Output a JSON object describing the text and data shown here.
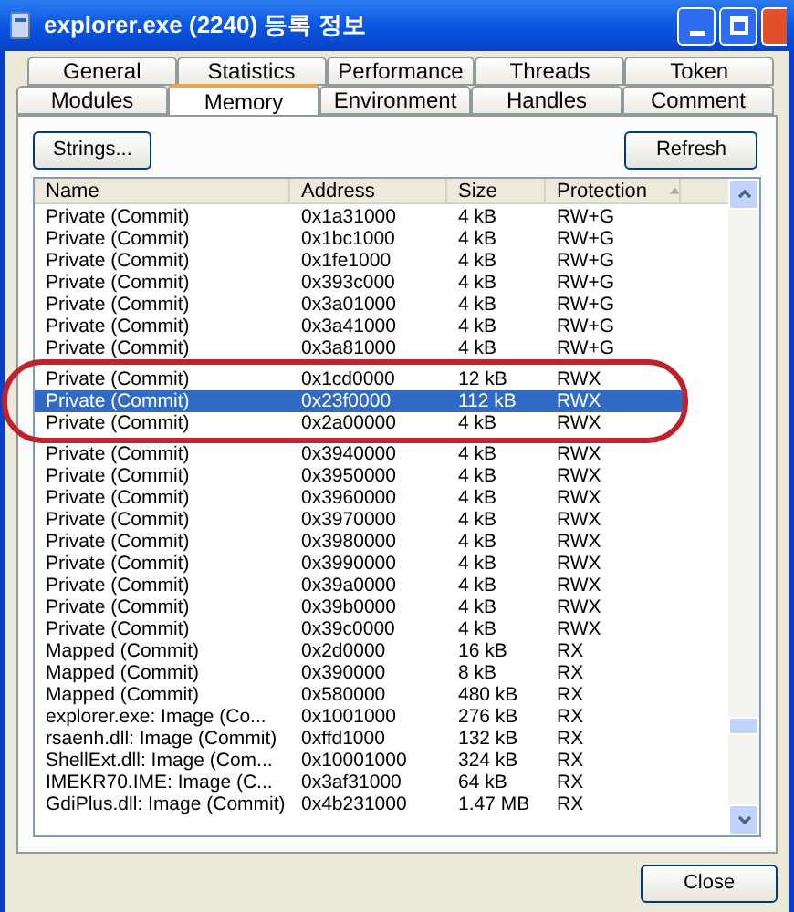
{
  "window": {
    "title": "explorer.exe (2240) 등록 정보"
  },
  "tab_rows": [
    [
      {
        "label": "General",
        "selected": false
      },
      {
        "label": "Statistics",
        "selected": false
      },
      {
        "label": "Performance",
        "selected": false
      },
      {
        "label": "Threads",
        "selected": false
      },
      {
        "label": "Token",
        "selected": false
      }
    ],
    [
      {
        "label": "Modules",
        "selected": false
      },
      {
        "label": "Memory",
        "selected": true
      },
      {
        "label": "Environment",
        "selected": false
      },
      {
        "label": "Handles",
        "selected": false
      },
      {
        "label": "Comment",
        "selected": false
      }
    ]
  ],
  "buttons": {
    "strings": "Strings...",
    "refresh": "Refresh",
    "close": "Close"
  },
  "table": {
    "columns": [
      "Name",
      "Address",
      "Size",
      "Protection"
    ],
    "rows": [
      {
        "cells": [
          "Private (Commit)",
          "0x1a31000",
          "4 kB",
          "RW+G"
        ],
        "selected": false,
        "circled": false
      },
      {
        "cells": [
          "Private (Commit)",
          "0x1bc1000",
          "4 kB",
          "RW+G"
        ],
        "selected": false,
        "circled": false
      },
      {
        "cells": [
          "Private (Commit)",
          "0x1fe1000",
          "4 kB",
          "RW+G"
        ],
        "selected": false,
        "circled": false
      },
      {
        "cells": [
          "Private (Commit)",
          "0x393c000",
          "4 kB",
          "RW+G"
        ],
        "selected": false,
        "circled": false
      },
      {
        "cells": [
          "Private (Commit)",
          "0x3a01000",
          "4 kB",
          "RW+G"
        ],
        "selected": false,
        "circled": false
      },
      {
        "cells": [
          "Private (Commit)",
          "0x3a41000",
          "4 kB",
          "RW+G"
        ],
        "selected": false,
        "circled": false
      },
      {
        "cells": [
          "Private (Commit)",
          "0x3a81000",
          "4 kB",
          "RW+G"
        ],
        "selected": false,
        "circled": false
      },
      {
        "cells": [
          "Private (Commit)",
          "0x1cd0000",
          "12 kB",
          "RWX"
        ],
        "selected": false,
        "circled": true
      },
      {
        "cells": [
          "Private (Commit)",
          "0x23f0000",
          "112 kB",
          "RWX"
        ],
        "selected": true,
        "circled": true
      },
      {
        "cells": [
          "Private (Commit)",
          "0x2a00000",
          "4 kB",
          "RWX"
        ],
        "selected": false,
        "circled": true
      },
      {
        "cells": [
          "Private (Commit)",
          "0x3940000",
          "4 kB",
          "RWX"
        ],
        "selected": false,
        "circled": false
      },
      {
        "cells": [
          "Private (Commit)",
          "0x3950000",
          "4 kB",
          "RWX"
        ],
        "selected": false,
        "circled": false
      },
      {
        "cells": [
          "Private (Commit)",
          "0x3960000",
          "4 kB",
          "RWX"
        ],
        "selected": false,
        "circled": false
      },
      {
        "cells": [
          "Private (Commit)",
          "0x3970000",
          "4 kB",
          "RWX"
        ],
        "selected": false,
        "circled": false
      },
      {
        "cells": [
          "Private (Commit)",
          "0x3980000",
          "4 kB",
          "RWX"
        ],
        "selected": false,
        "circled": false
      },
      {
        "cells": [
          "Private (Commit)",
          "0x3990000",
          "4 kB",
          "RWX"
        ],
        "selected": false,
        "circled": false
      },
      {
        "cells": [
          "Private (Commit)",
          "0x39a0000",
          "4 kB",
          "RWX"
        ],
        "selected": false,
        "circled": false
      },
      {
        "cells": [
          "Private (Commit)",
          "0x39b0000",
          "4 kB",
          "RWX"
        ],
        "selected": false,
        "circled": false
      },
      {
        "cells": [
          "Private (Commit)",
          "0x39c0000",
          "4 kB",
          "RWX"
        ],
        "selected": false,
        "circled": false
      },
      {
        "cells": [
          "Mapped (Commit)",
          "0x2d0000",
          "16 kB",
          "RX"
        ],
        "selected": false,
        "circled": false
      },
      {
        "cells": [
          "Mapped (Commit)",
          "0x390000",
          "8 kB",
          "RX"
        ],
        "selected": false,
        "circled": false
      },
      {
        "cells": [
          "Mapped (Commit)",
          "0x580000",
          "480 kB",
          "RX"
        ],
        "selected": false,
        "circled": false
      },
      {
        "cells": [
          "explorer.exe: Image (Co...",
          "0x1001000",
          "276 kB",
          "RX"
        ],
        "selected": false,
        "circled": false
      },
      {
        "cells": [
          "rsaenh.dll: Image (Commit)",
          "0xffd1000",
          "132 kB",
          "RX"
        ],
        "selected": false,
        "circled": false
      },
      {
        "cells": [
          "ShellExt.dll: Image (Com...",
          "0x10001000",
          "324 kB",
          "RX"
        ],
        "selected": false,
        "circled": false
      },
      {
        "cells": [
          "IMEKR70.IME: Image (C...",
          "0x3af31000",
          "64 kB",
          "RX"
        ],
        "selected": false,
        "circled": false
      },
      {
        "cells": [
          "GdiPlus.dll: Image (Commit)",
          "0x4b231000",
          "1.47 MB",
          "RX"
        ],
        "selected": false,
        "circled": false
      }
    ]
  }
}
